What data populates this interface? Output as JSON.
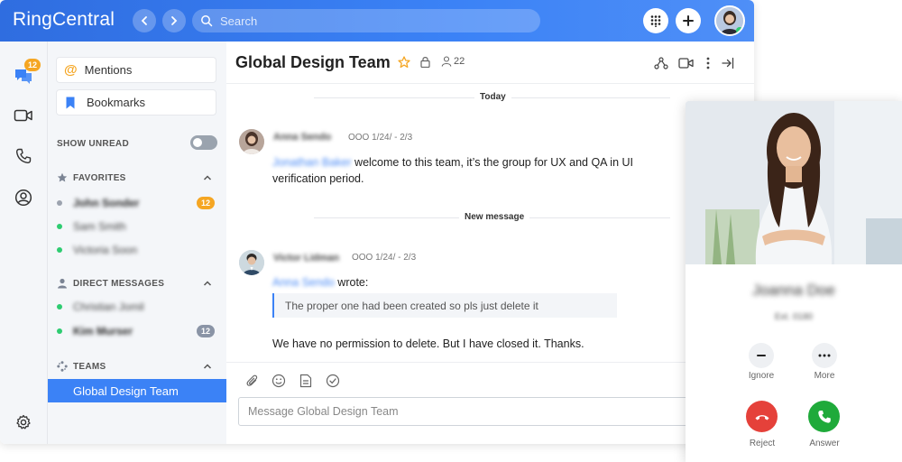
{
  "header": {
    "logo": "RingCentral",
    "search_placeholder": "Search"
  },
  "rail": {
    "messages_badge": "12"
  },
  "sidebar": {
    "mentions_label": "Mentions",
    "bookmarks_label": "Bookmarks",
    "show_unread_label": "SHOW UNREAD",
    "favorites_label": "FAVORITES",
    "favorites": [
      {
        "name": "John Sonder",
        "status_color": "#9ca3af",
        "badge": "12",
        "badge_color": "#f5a623",
        "bold": true
      },
      {
        "name": "Sam Smith",
        "status_color": "#2ecc71"
      },
      {
        "name": "Victoria Soon",
        "status_color": "#2ecc71"
      }
    ],
    "direct_messages_label": "DIRECT MESSAGES",
    "direct_messages": [
      {
        "name": "Christian Jomil",
        "status_color": "#2ecc71"
      },
      {
        "name": "Kim Murser",
        "status_color": "#2ecc71",
        "badge": "12",
        "badge_color": "#8a94a6",
        "bold": true
      }
    ],
    "teams_label": "TEAMS",
    "active_team": "Global Design Team"
  },
  "conversation": {
    "title": "Global Design Team",
    "member_count": "22",
    "divider_today": "Today",
    "divider_new": "New message",
    "messages": [
      {
        "author": "Anna Sendo",
        "time": "OOO 1/24/ - 2/3",
        "mention": "Jonathan Baker",
        "text": "welcome to this team, it’s the group for UX and QA in UI verification period."
      },
      {
        "author": "Victor Lidman",
        "time": "OOO 1/24/ - 2/3",
        "mention": "Anna Sendo",
        "wrote": "wrote:",
        "quote": "The proper one had been created so pls just delete it",
        "text": "We have no permission to delete. But I have closed it. Thanks."
      }
    ],
    "compose_placeholder": "Message Global Design Team"
  },
  "call": {
    "caller_name": "Joanna Doe",
    "caller_ext": "Ext. 0180",
    "ignore_label": "Ignore",
    "more_label": "More",
    "reject_label": "Reject",
    "answer_label": "Answer"
  },
  "colors": {
    "brand_blue": "#3b82f6",
    "reject_red": "#e5413a",
    "answer_green": "#1faa3a",
    "badge_orange": "#f5a623"
  }
}
